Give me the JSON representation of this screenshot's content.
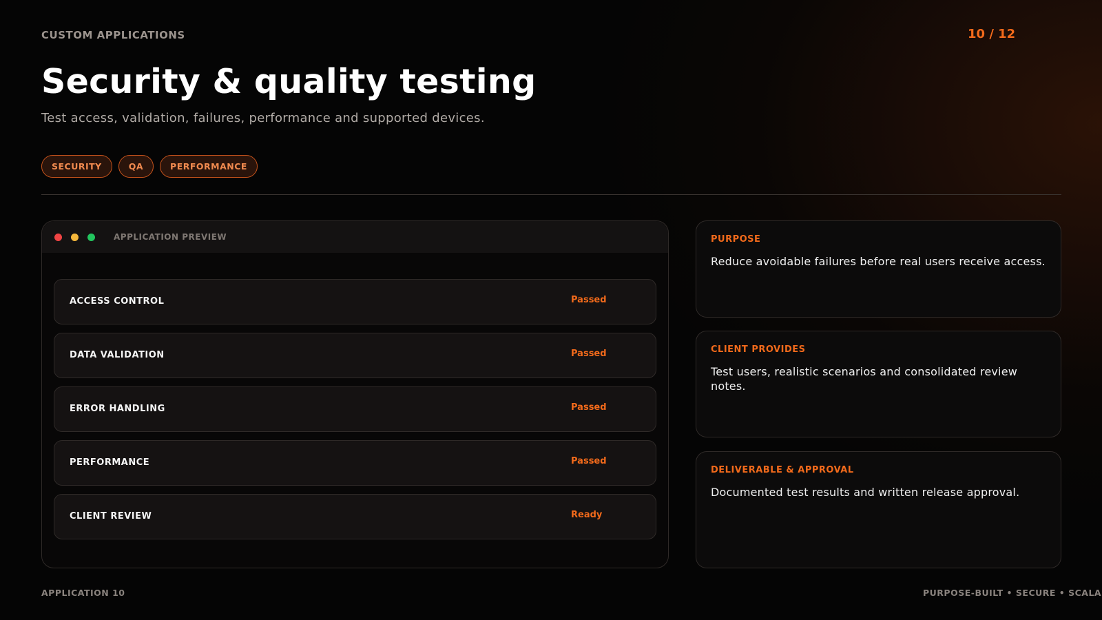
{
  "header": {
    "eyebrow": "CUSTOM APPLICATIONS",
    "page_counter": "10 / 12",
    "title": "Security & quality testing",
    "subtitle": "Test access, validation, failures, performance and supported devices."
  },
  "tags": [
    "SECURITY",
    "QA",
    "PERFORMANCE"
  ],
  "preview": {
    "label": "APPLICATION PREVIEW",
    "rows": [
      {
        "label": "ACCESS CONTROL",
        "status": "Passed"
      },
      {
        "label": "DATA VALIDATION",
        "status": "Passed"
      },
      {
        "label": "ERROR HANDLING",
        "status": "Passed"
      },
      {
        "label": "PERFORMANCE",
        "status": "Passed"
      },
      {
        "label": "CLIENT REVIEW",
        "status": "Ready"
      }
    ]
  },
  "cards": [
    {
      "title": "PURPOSE",
      "body": "Reduce avoidable failures before real users receive access."
    },
    {
      "title": "CLIENT PROVIDES",
      "body": "Test users, realistic scenarios and consolidated review notes."
    },
    {
      "title": "DELIVERABLE & APPROVAL",
      "body": "Documented test results and written release approval."
    }
  ],
  "footer": {
    "left": "APPLICATION 10",
    "right": "PURPOSE-BUILT • SECURE • SCALABLE"
  },
  "colors": {
    "accent": "#f26a1b",
    "background": "#050505",
    "traffic_red": "#ef4444",
    "traffic_yellow": "#f5b73b",
    "traffic_green": "#22c55e"
  }
}
